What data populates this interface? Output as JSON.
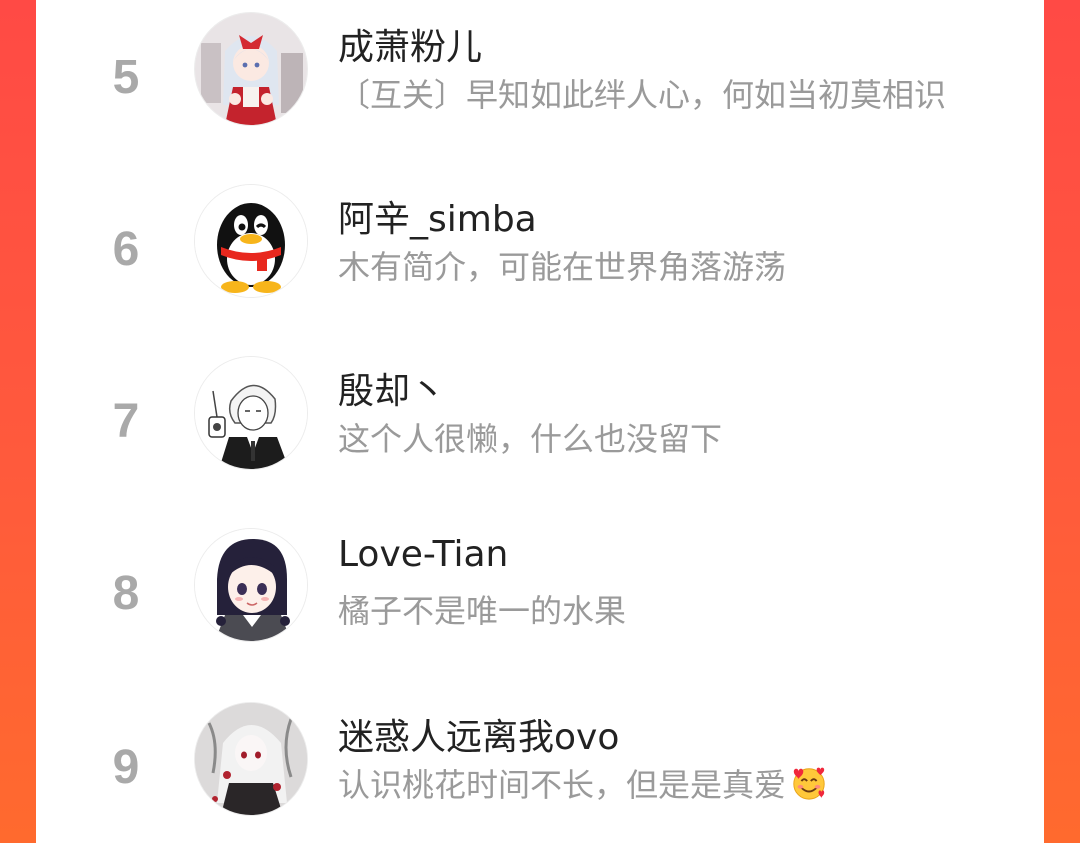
{
  "list": {
    "items": [
      {
        "rank": "5",
        "name": "成萧粉儿",
        "bio": "〔互关〕早知如此绊人心，何如当初莫相识",
        "avatar": "anime-girl-red-bow-avatar"
      },
      {
        "rank": "6",
        "name": "阿辛_simba",
        "bio": "木有简介，可能在世界角落游荡",
        "avatar": "qq-penguin-avatar"
      },
      {
        "rank": "7",
        "name": "殷却丶",
        "bio": "这个人很懒，什么也没留下",
        "avatar": "sketch-boy-lantern-avatar"
      },
      {
        "rank": "8",
        "name": "Love-Tian",
        "bio": "橘子不是唯一的水果",
        "avatar": "anime-girl-braids-avatar"
      },
      {
        "rank": "9",
        "name": "迷惑人远离我ovo",
        "bio": "认识桃花时间不长，但是是真爱",
        "avatar": "gothic-white-hair-avatar",
        "emoji": "smiling-face-with-hearts-emoji"
      }
    ]
  },
  "colors": {
    "background_gradient_top": "#ff4a45",
    "background_gradient_bottom": "#ff6a2e",
    "rank_text": "#a9a9a9",
    "name_text": "#222222",
    "bio_text": "#9a9a9a"
  }
}
